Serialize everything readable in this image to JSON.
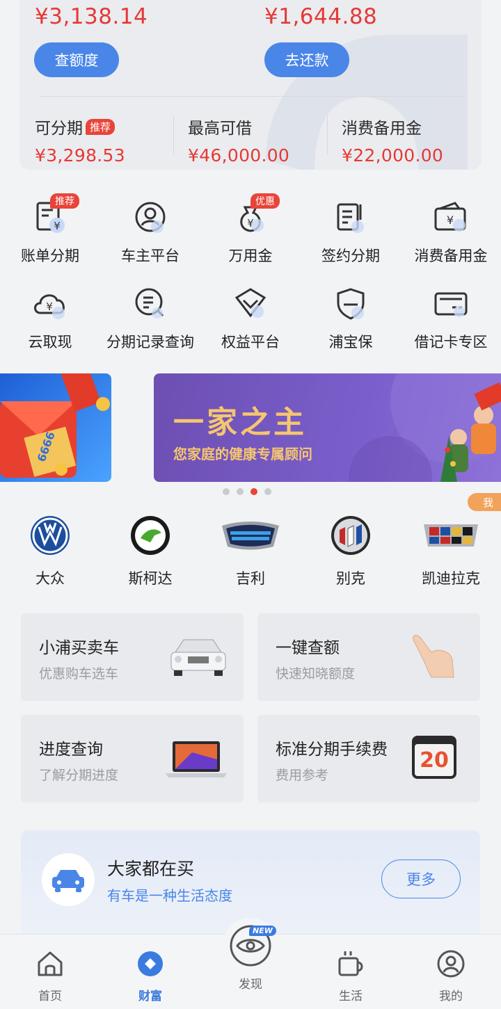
{
  "account": {
    "amount_left": "¥3,138.14",
    "amount_right": "¥1,644.88",
    "btn_left": "查额度",
    "btn_right": "去还款",
    "stats": [
      {
        "label": "可分期",
        "badge": "推荐",
        "value": "¥3,298.53"
      },
      {
        "label": "最高可借",
        "value": "¥46,000.00"
      },
      {
        "label": "消费备用金",
        "value": "¥22,000.00"
      }
    ]
  },
  "grid": [
    {
      "label": "账单分期",
      "badge": "推荐",
      "icon": "bill-yen-icon"
    },
    {
      "label": "车主平台",
      "icon": "user-circle-icon"
    },
    {
      "label": "万用金",
      "badge": "优惠",
      "icon": "money-bag-icon"
    },
    {
      "label": "签约分期",
      "icon": "contract-icon"
    },
    {
      "label": "消费备用金",
      "icon": "wallet-yen-icon"
    },
    {
      "label": "云取现",
      "icon": "cloud-yen-icon"
    },
    {
      "label": "分期记录查询",
      "icon": "search-record-icon"
    },
    {
      "label": "权益平台",
      "icon": "diamond-icon"
    },
    {
      "label": "浦宝保",
      "icon": "shield-icon"
    },
    {
      "label": "借记卡专区",
      "icon": "card-icon"
    }
  ],
  "banner": {
    "left_text": "6666",
    "title": "一家之主",
    "subtitle": "您家庭的健康专属顾问",
    "active_dot": 2,
    "me_tag": "我"
  },
  "brands": [
    {
      "label": "大众",
      "icon": "volkswagen-logo-icon"
    },
    {
      "label": "斯柯达",
      "icon": "skoda-logo-icon"
    },
    {
      "label": "吉利",
      "icon": "geely-logo-icon"
    },
    {
      "label": "别克",
      "icon": "buick-logo-icon"
    },
    {
      "label": "凯迪拉克",
      "icon": "cadillac-logo-icon"
    }
  ],
  "services": [
    {
      "title": "小浦买卖车",
      "sub": "优惠购车选车",
      "icon": "car-image-icon"
    },
    {
      "title": "一键查额",
      "sub": "快速知晓额度",
      "icon": "hand-pointer-icon"
    },
    {
      "title": "进度查询",
      "sub": "了解分期进度",
      "icon": "laptop-icon"
    },
    {
      "title": "标准分期手续费",
      "sub": "费用参考",
      "icon": "calendar-icon",
      "calendar_num": "20"
    }
  ],
  "promo": {
    "title": "大家都在买",
    "subtitle": "有车是一种生活态度",
    "more": "更多"
  },
  "tabs": [
    {
      "label": "首页",
      "icon": "home-icon"
    },
    {
      "label": "财富",
      "icon": "wealth-icon",
      "active": true
    },
    {
      "label": "发现",
      "icon": "discover-eye-icon",
      "badge": "NEW"
    },
    {
      "label": "生活",
      "icon": "coffee-cup-icon"
    },
    {
      "label": "我的",
      "icon": "profile-icon"
    }
  ],
  "colors": {
    "accent": "#4a86e8",
    "red": "#e53935",
    "tab_active": "#3b7be0"
  }
}
